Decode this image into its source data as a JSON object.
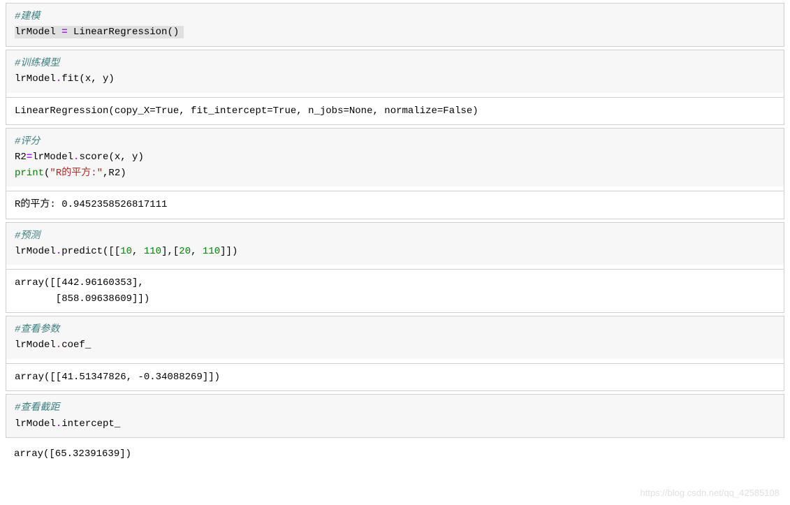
{
  "cells": [
    {
      "code": {
        "comment1": "#建模",
        "line2_a": "lrModel ",
        "line2_op": "=",
        "line2_b": " LinearRegression()"
      },
      "output": null,
      "selected": true
    },
    {
      "code": {
        "comment1": "#训练模型",
        "line2_a": "lrModel",
        "line2_b": ".",
        "line2_c": "fit(x, y)"
      },
      "output": "LinearRegression(copy_X=True, fit_intercept=True, n_jobs=None, normalize=False)"
    },
    {
      "code": {
        "comment1": "#评分",
        "line2_a": "R2",
        "line2_op": "=",
        "line2_b": "lrModel",
        "line2_c": ".",
        "line2_d": "score(x, y)",
        "line3_print": "print",
        "line3_a": "(",
        "line3_str": "\"R的平方:\"",
        "line3_b": ",R2)"
      },
      "output": "R的平方: 0.9452358526817111"
    },
    {
      "code": {
        "comment1": "#预测",
        "line2_a": "lrModel",
        "line2_b": ".",
        "line2_c": "predict([[",
        "line2_n1": "10",
        "line2_d": ", ",
        "line2_n2": "110",
        "line2_e": "],[",
        "line2_n3": "20",
        "line2_f": ", ",
        "line2_n4": "110",
        "line2_g": "]])"
      },
      "output": "array([[442.96160353],\n       [858.09638609]])"
    },
    {
      "code": {
        "comment1": "#查看参数",
        "line2_a": "lrModel",
        "line2_b": ".",
        "line2_c": "coef_"
      },
      "output": "array([[41.51347826, -0.34088269]])"
    },
    {
      "code": {
        "comment1": "#查看截距",
        "line2_a": "lrModel",
        "line2_b": ".",
        "line2_c": "intercept_"
      },
      "output": "array([65.32391639])"
    }
  ],
  "watermark": "https://blog.csdn.net/qq_42585108"
}
